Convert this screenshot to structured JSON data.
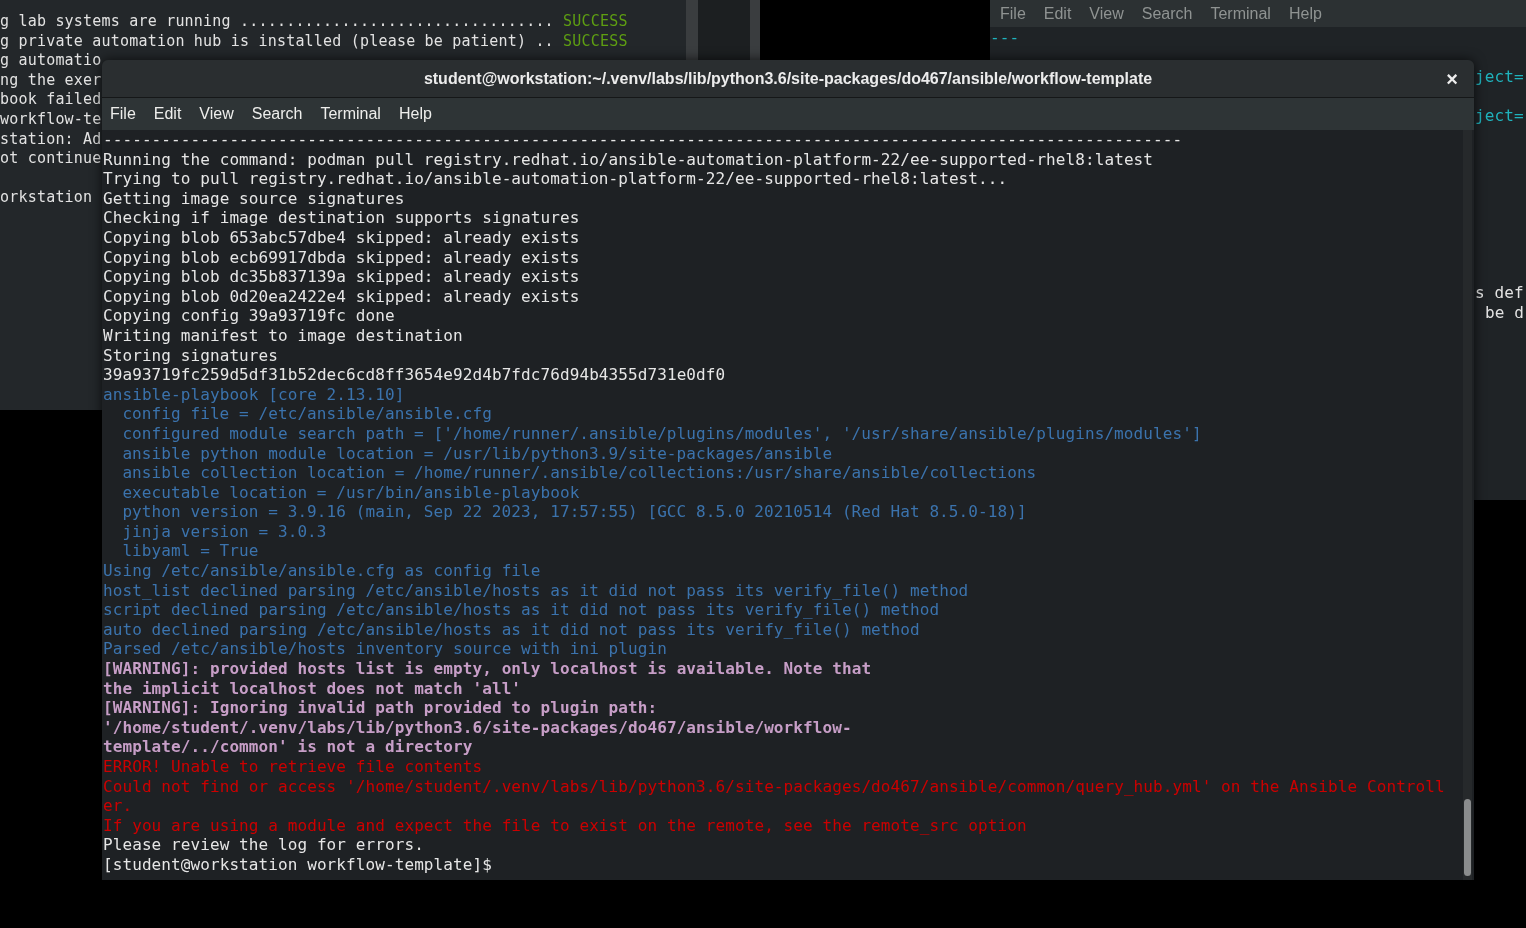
{
  "left_terminal": {
    "lines": [
      {
        "text": "g lab systems are running .................................. ",
        "status": "SUCCESS"
      },
      {
        "text": "g private automation hub is installed (please be patient) .. ",
        "status": "SUCCESS"
      },
      {
        "text": "g automatio"
      },
      {
        "text": "ng the exer"
      },
      {
        "text": "book failed"
      },
      {
        "text": "workflow-te"
      },
      {
        "text": "station: Ad"
      },
      {
        "text": "ot continue"
      },
      {
        "text": "orkstation"
      }
    ]
  },
  "right_terminal": {
    "menu": [
      "File",
      "Edit",
      "View",
      "Search",
      "Terminal",
      "Help"
    ],
    "lines": [
      "---"
    ],
    "edge_fragments": [
      "ject=",
      "ject=",
      "s def",
      "be d"
    ]
  },
  "window": {
    "title": "student@workstation:~/.venv/labs/lib/python3.6/site-packages/do467/ansible/workflow-template",
    "close": "×",
    "menu": [
      "File",
      "Edit",
      "View",
      "Search",
      "Terminal",
      "Help"
    ],
    "lines": [
      {
        "kind": "plain",
        "indented": false,
        "text": "---------------------------------------------------------------------------------------------------------------"
      },
      {
        "kind": "plain",
        "indented": false,
        "text": "Running the command: podman pull registry.redhat.io/ansible-automation-platform-22/ee-supported-rhel8:latest"
      },
      {
        "kind": "plain",
        "indented": false,
        "text": "Trying to pull registry.redhat.io/ansible-automation-platform-22/ee-supported-rhel8:latest..."
      },
      {
        "kind": "plain",
        "indented": false,
        "text": "Getting image source signatures"
      },
      {
        "kind": "plain",
        "indented": false,
        "text": "Checking if image destination supports signatures"
      },
      {
        "kind": "plain",
        "indented": false,
        "text": "Copying blob 653abc57dbe4 skipped: already exists"
      },
      {
        "kind": "plain",
        "indented": false,
        "text": "Copying blob ecb69917dbda skipped: already exists"
      },
      {
        "kind": "plain",
        "indented": false,
        "text": "Copying blob dc35b837139a skipped: already exists"
      },
      {
        "kind": "plain",
        "indented": false,
        "text": "Copying blob 0d20ea2422e4 skipped: already exists"
      },
      {
        "kind": "plain",
        "indented": false,
        "text": "Copying config 39a93719fc done"
      },
      {
        "kind": "plain",
        "indented": false,
        "text": "Writing manifest to image destination"
      },
      {
        "kind": "plain",
        "indented": false,
        "text": "Storing signatures"
      },
      {
        "kind": "plain",
        "indented": false,
        "text": "39a93719fc259d5df31b52dec6cd8ff3654e92d4b7fdc76d94b4355d731e0df0"
      },
      {
        "kind": "info",
        "indented": false,
        "text": "ansible-playbook [core 2.13.10]"
      },
      {
        "kind": "info",
        "indented": true,
        "text": "config file = /etc/ansible/ansible.cfg"
      },
      {
        "kind": "info",
        "indented": true,
        "text": "configured module search path = ['/home/runner/.ansible/plugins/modules', '/usr/share/ansible/plugins/modules']"
      },
      {
        "kind": "info",
        "indented": true,
        "text": "ansible python module location = /usr/lib/python3.9/site-packages/ansible"
      },
      {
        "kind": "info",
        "indented": true,
        "text": "ansible collection location = /home/runner/.ansible/collections:/usr/share/ansible/collections"
      },
      {
        "kind": "info",
        "indented": true,
        "text": "executable location = /usr/bin/ansible-playbook"
      },
      {
        "kind": "info",
        "indented": true,
        "text": "python version = 3.9.16 (main, Sep 22 2023, 17:57:55) [GCC 8.5.0 20210514 (Red Hat 8.5.0-18)]"
      },
      {
        "kind": "info",
        "indented": true,
        "text": "jinja version = 3.0.3"
      },
      {
        "kind": "info",
        "indented": true,
        "text": "libyaml = True"
      },
      {
        "kind": "info",
        "indented": false,
        "text": "Using /etc/ansible/ansible.cfg as config file"
      },
      {
        "kind": "info",
        "indented": false,
        "text": "host_list declined parsing /etc/ansible/hosts as it did not pass its verify_file() method"
      },
      {
        "kind": "info",
        "indented": false,
        "text": "script declined parsing /etc/ansible/hosts as it did not pass its verify_file() method"
      },
      {
        "kind": "info",
        "indented": false,
        "text": "auto declined parsing /etc/ansible/hosts as it did not pass its verify_file() method"
      },
      {
        "kind": "info",
        "indented": false,
        "text": "Parsed /etc/ansible/hosts inventory source with ini plugin"
      },
      {
        "kind": "warning",
        "indented": false,
        "text": "[WARNING]: provided hosts list is empty, only localhost is available. Note that"
      },
      {
        "kind": "warning",
        "indented": false,
        "text": "the implicit localhost does not match 'all'"
      },
      {
        "kind": "warning",
        "indented": false,
        "text": "[WARNING]: Ignoring invalid path provided to plugin path:"
      },
      {
        "kind": "warning",
        "indented": false,
        "text": "'/home/student/.venv/labs/lib/python3.6/site-packages/do467/ansible/workflow-"
      },
      {
        "kind": "warning",
        "indented": false,
        "text": "template/../common' is not a directory"
      },
      {
        "kind": "error",
        "indented": false,
        "text": "ERROR! Unable to retrieve file contents"
      },
      {
        "kind": "error",
        "indented": false,
        "text": "Could not find or access '/home/student/.venv/labs/lib/python3.6/site-packages/do467/ansible/common/query_hub.yml' on the Ansible Controll"
      },
      {
        "kind": "error",
        "indented": false,
        "text": "er."
      },
      {
        "kind": "error",
        "indented": false,
        "text": "If you are using a module and expect the file to exist on the remote, see the remote_src option"
      },
      {
        "kind": "plain",
        "indented": false,
        "text": "Please review the log for errors."
      },
      {
        "kind": "plain",
        "indented": false,
        "text": "[student@workstation workflow-template]$"
      }
    ]
  }
}
